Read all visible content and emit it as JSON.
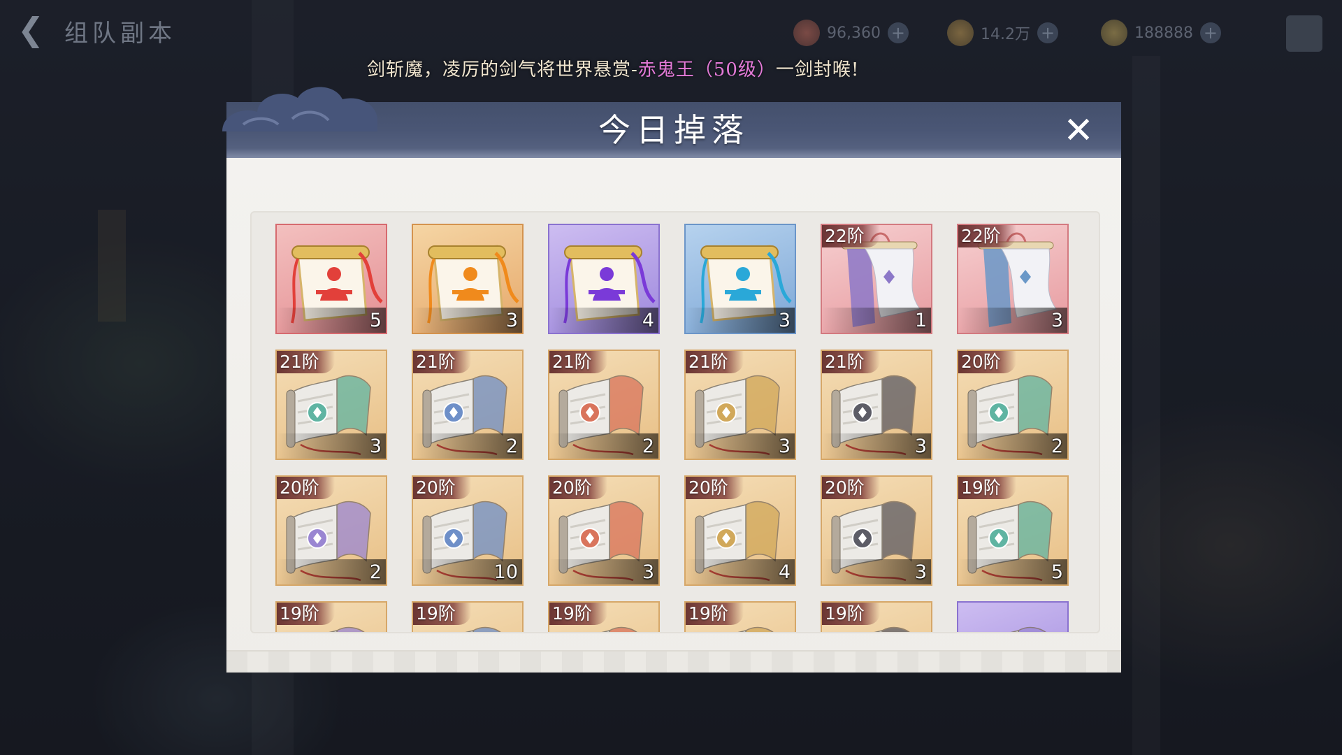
{
  "topbar": {
    "back_icon": "back-arrow-icon",
    "title": "组队副本",
    "resources": [
      {
        "icon": "gem-icon",
        "value": "96,360",
        "color": "#e0654e"
      },
      {
        "icon": "coin-icon",
        "value": "14.2万",
        "color": "#d6a23c"
      },
      {
        "icon": "gold-icon",
        "value": "188888",
        "color": "#d8b44a"
      }
    ]
  },
  "ticker": {
    "text_before": "剑斩魔，凌厉的剑气将世界悬赏-",
    "highlight": "赤鬼王（50级）",
    "text_after": "一剑封喉!"
  },
  "dialog": {
    "title": "今日掉落",
    "close_icon": "close-icon"
  },
  "items": [
    {
      "kind": "meditation-scroll",
      "quality": "red",
      "count": "5",
      "tier": "",
      "accent": "#e2403a"
    },
    {
      "kind": "meditation-scroll",
      "quality": "orange",
      "count": "3",
      "tier": "",
      "accent": "#f08a1c"
    },
    {
      "kind": "meditation-scroll",
      "quality": "purple",
      "count": "4",
      "tier": "",
      "accent": "#7a3ad8"
    },
    {
      "kind": "meditation-scroll",
      "quality": "blue",
      "count": "3",
      "tier": "",
      "accent": "#2aa8d8"
    },
    {
      "kind": "banner-scroll",
      "quality": "pink",
      "count": "1",
      "tier": "22阶",
      "accent": "#8c78c8"
    },
    {
      "kind": "banner-scroll",
      "quality": "pink",
      "count": "3",
      "tier": "22阶",
      "accent": "#6a98c8"
    },
    {
      "kind": "skill-scroll",
      "quality": "tan",
      "count": "3",
      "tier": "21阶",
      "accent": "#5fb4a2"
    },
    {
      "kind": "skill-scroll",
      "quality": "tan",
      "count": "2",
      "tier": "21阶",
      "accent": "#6e8fc8"
    },
    {
      "kind": "skill-scroll",
      "quality": "tan",
      "count": "2",
      "tier": "21阶",
      "accent": "#d9745c"
    },
    {
      "kind": "skill-scroll",
      "quality": "tan",
      "count": "3",
      "tier": "21阶",
      "accent": "#d1a85a"
    },
    {
      "kind": "skill-scroll",
      "quality": "tan",
      "count": "3",
      "tier": "21阶",
      "accent": "#5c5c66"
    },
    {
      "kind": "skill-scroll",
      "quality": "tan",
      "count": "2",
      "tier": "20阶",
      "accent": "#5fb4a2"
    },
    {
      "kind": "skill-scroll",
      "quality": "tan",
      "count": "2",
      "tier": "20阶",
      "accent": "#9a86d2"
    },
    {
      "kind": "skill-scroll",
      "quality": "tan",
      "count": "10",
      "tier": "20阶",
      "accent": "#6e8fc8"
    },
    {
      "kind": "skill-scroll",
      "quality": "tan",
      "count": "3",
      "tier": "20阶",
      "accent": "#d9745c"
    },
    {
      "kind": "skill-scroll",
      "quality": "tan",
      "count": "4",
      "tier": "20阶",
      "accent": "#d1a85a"
    },
    {
      "kind": "skill-scroll",
      "quality": "tan",
      "count": "3",
      "tier": "20阶",
      "accent": "#5c5c66"
    },
    {
      "kind": "skill-scroll",
      "quality": "tan",
      "count": "5",
      "tier": "19阶",
      "accent": "#5fb4a2"
    },
    {
      "kind": "skill-scroll",
      "quality": "tan",
      "count": "",
      "tier": "19阶",
      "accent": "#9a86d2"
    },
    {
      "kind": "skill-scroll",
      "quality": "tan",
      "count": "",
      "tier": "19阶",
      "accent": "#6e8fc8"
    },
    {
      "kind": "skill-scroll",
      "quality": "tan",
      "count": "",
      "tier": "19阶",
      "accent": "#d9745c"
    },
    {
      "kind": "skill-scroll",
      "quality": "tan",
      "count": "",
      "tier": "19阶",
      "accent": "#d1a85a"
    },
    {
      "kind": "skill-scroll",
      "quality": "tan",
      "count": "",
      "tier": "19阶",
      "accent": "#5c5c66"
    },
    {
      "kind": "skill-scroll",
      "quality": "purple",
      "count": "",
      "tier": "",
      "accent": "#9a86d2"
    }
  ]
}
